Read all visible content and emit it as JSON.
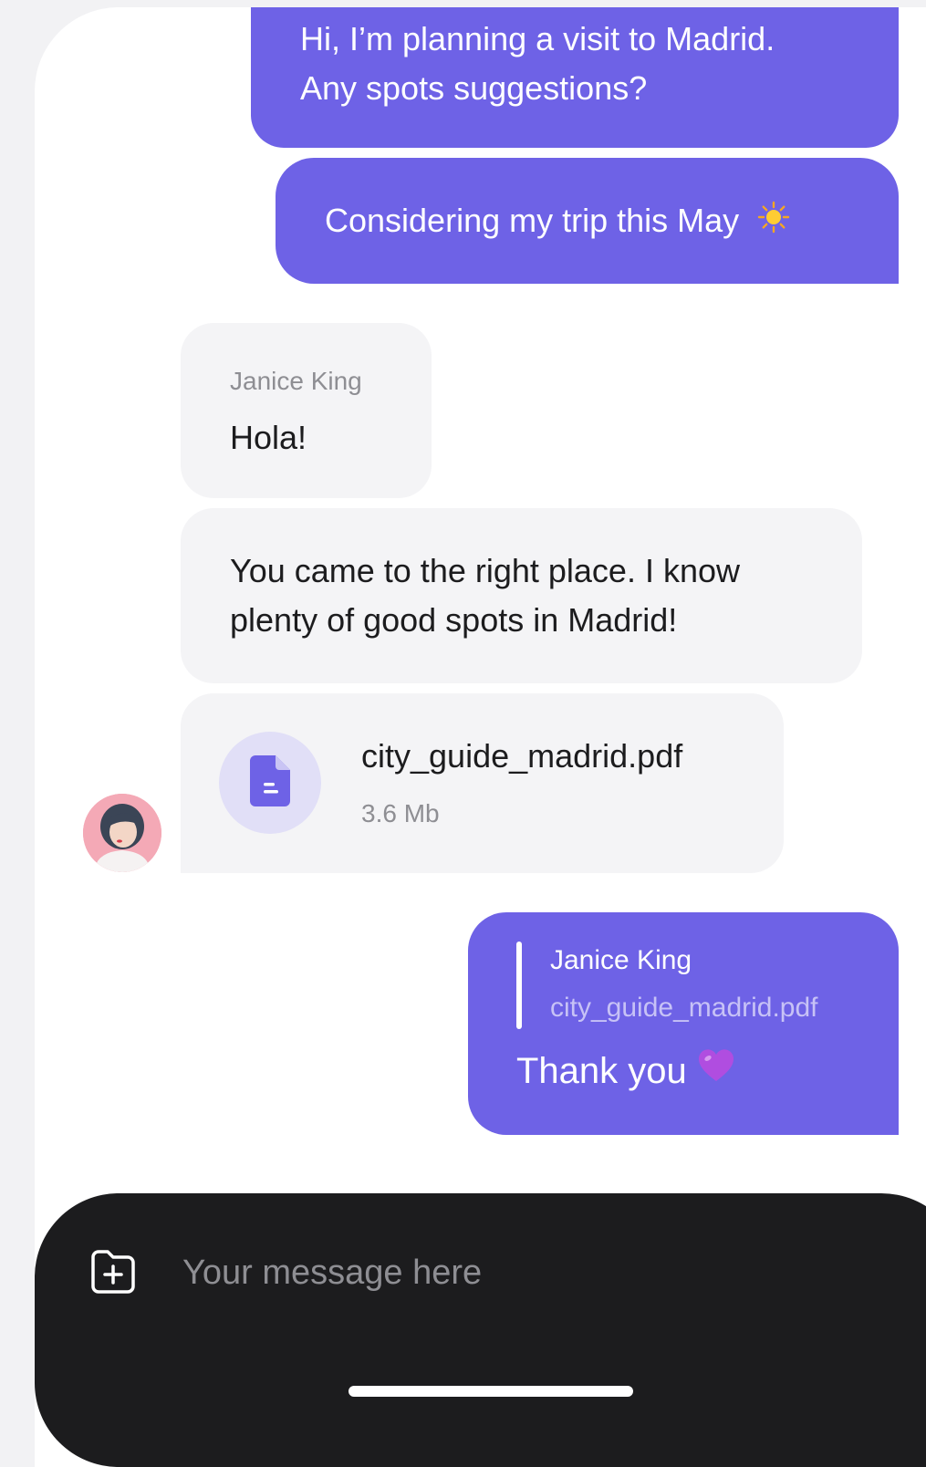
{
  "colors": {
    "outgoing_bubble": "#6e62e6",
    "incoming_bubble": "#f4f4f6",
    "composer_background": "#1c1c1e",
    "file_icon_circle": "#e1dff7"
  },
  "messages": {
    "m1": {
      "line1": "Hi, I’m planning a visit to Madrid.",
      "line2": "Any spots suggestions?"
    },
    "m2": {
      "text": "Considering my trip this May",
      "emoji_icon": "sun-icon"
    },
    "m3": {
      "sender": "Janice King",
      "text": "Hola!"
    },
    "m4": {
      "line1": "You came to the right place. I know",
      "line2": "plenty of good spots in Madrid!"
    },
    "m5": {
      "file_name": "city_guide_madrid.pdf",
      "file_size": "3.6 Mb",
      "icon": "document-icon"
    },
    "m6": {
      "quote_sender": "Janice King",
      "quote_file": "city_guide_madrid.pdf",
      "text": "Thank you",
      "emoji_icon": "purple-heart-icon"
    }
  },
  "composer": {
    "placeholder": "Your message here",
    "value": "",
    "attach_icon": "folder-plus-icon"
  }
}
